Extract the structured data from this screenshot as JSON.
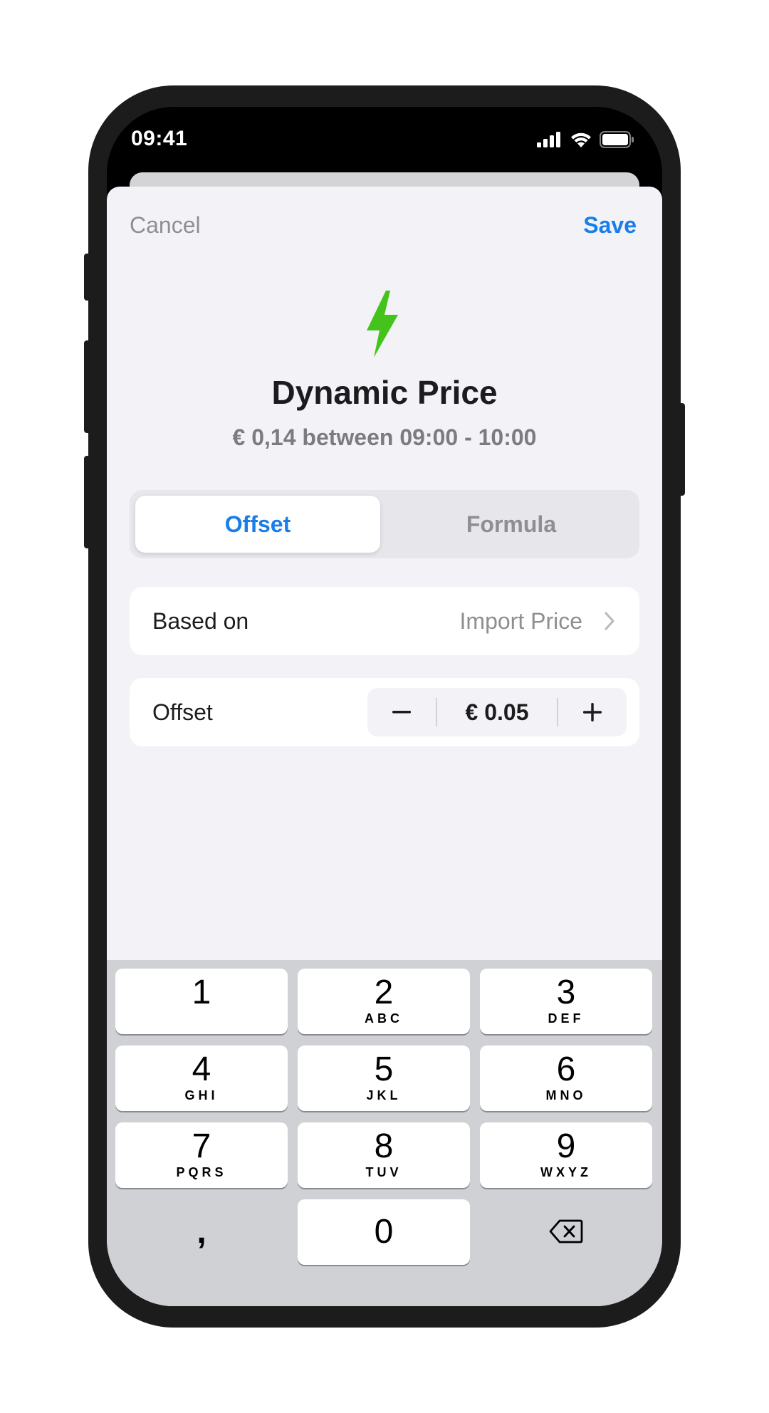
{
  "status_bar": {
    "time": "09:41",
    "icons": [
      "cellular-signal-icon",
      "wifi-icon",
      "battery-icon"
    ]
  },
  "nav": {
    "cancel_label": "Cancel",
    "save_label": "Save"
  },
  "header": {
    "icon": "lightning-bolt-icon",
    "icon_color": "#44c41a",
    "title": "Dynamic Price",
    "subtitle": "€ 0,14 between 09:00 - 10:00"
  },
  "segmented_control": {
    "segments": [
      "Offset",
      "Formula"
    ],
    "selected": "Offset"
  },
  "based_on_row": {
    "label": "Based on",
    "value": "Import Price"
  },
  "offset_row": {
    "label": "Offset",
    "value": "€ 0.05",
    "minus": "−",
    "plus": "+"
  },
  "keyboard": {
    "keys": [
      {
        "num": "1",
        "letters": ""
      },
      {
        "num": "2",
        "letters": "ABC"
      },
      {
        "num": "3",
        "letters": "DEF"
      },
      {
        "num": "4",
        "letters": "GHI"
      },
      {
        "num": "5",
        "letters": "JKL"
      },
      {
        "num": "6",
        "letters": "MNO"
      },
      {
        "num": "7",
        "letters": "PQRS"
      },
      {
        "num": "8",
        "letters": "TUV"
      },
      {
        "num": "9",
        "letters": "WXYZ"
      },
      {
        "num": "0",
        "letters": ""
      }
    ],
    "comma": ",",
    "delete_icon": "backspace-icon"
  },
  "colors": {
    "accent": "#1a7ee8",
    "bolt": "#44c41a",
    "sheet_background": "#f2f2f7",
    "keyboard_background": "#d0d1d5"
  }
}
